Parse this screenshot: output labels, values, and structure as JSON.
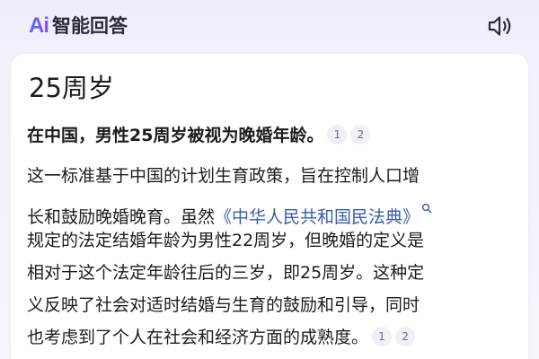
{
  "header": {
    "logo_text": "Ai",
    "title": "智能回答"
  },
  "card": {
    "title": "25周岁",
    "summary": "在中国，男性25周岁被视为晚婚年龄。",
    "summary_refs": [
      "1",
      "2"
    ],
    "body": {
      "line1": "这一标准基于中国的计划生育政策，旨在控制人口增",
      "line2_prefix": "长和鼓励晚婚晚育。虽然",
      "law_link": "《中华人民共和国民法典》",
      "line3": "规定的法定结婚年龄为男性22周岁，但晚婚的定义是",
      "line4": "相对于这个法定年龄往后的三岁，即25周岁。这种定",
      "line5": "义反映了社会对适时结婚与生育的鼓励和引导，同时",
      "line6": "也考虑到了个人在社会和经济方面的成熟度。",
      "line6_refs": [
        "1",
        "2"
      ]
    }
  },
  "colors": {
    "background": "#f0f0fb",
    "card": "#ffffff",
    "text": "#1c1c1e",
    "link": "#3b5ba9",
    "ref_badge": "#eef0f5",
    "logo_gradient_start": "#4f6bff",
    "logo_gradient_end": "#8a4dff"
  },
  "icons": {
    "speaker": "speaker-icon",
    "search": "search-icon"
  }
}
